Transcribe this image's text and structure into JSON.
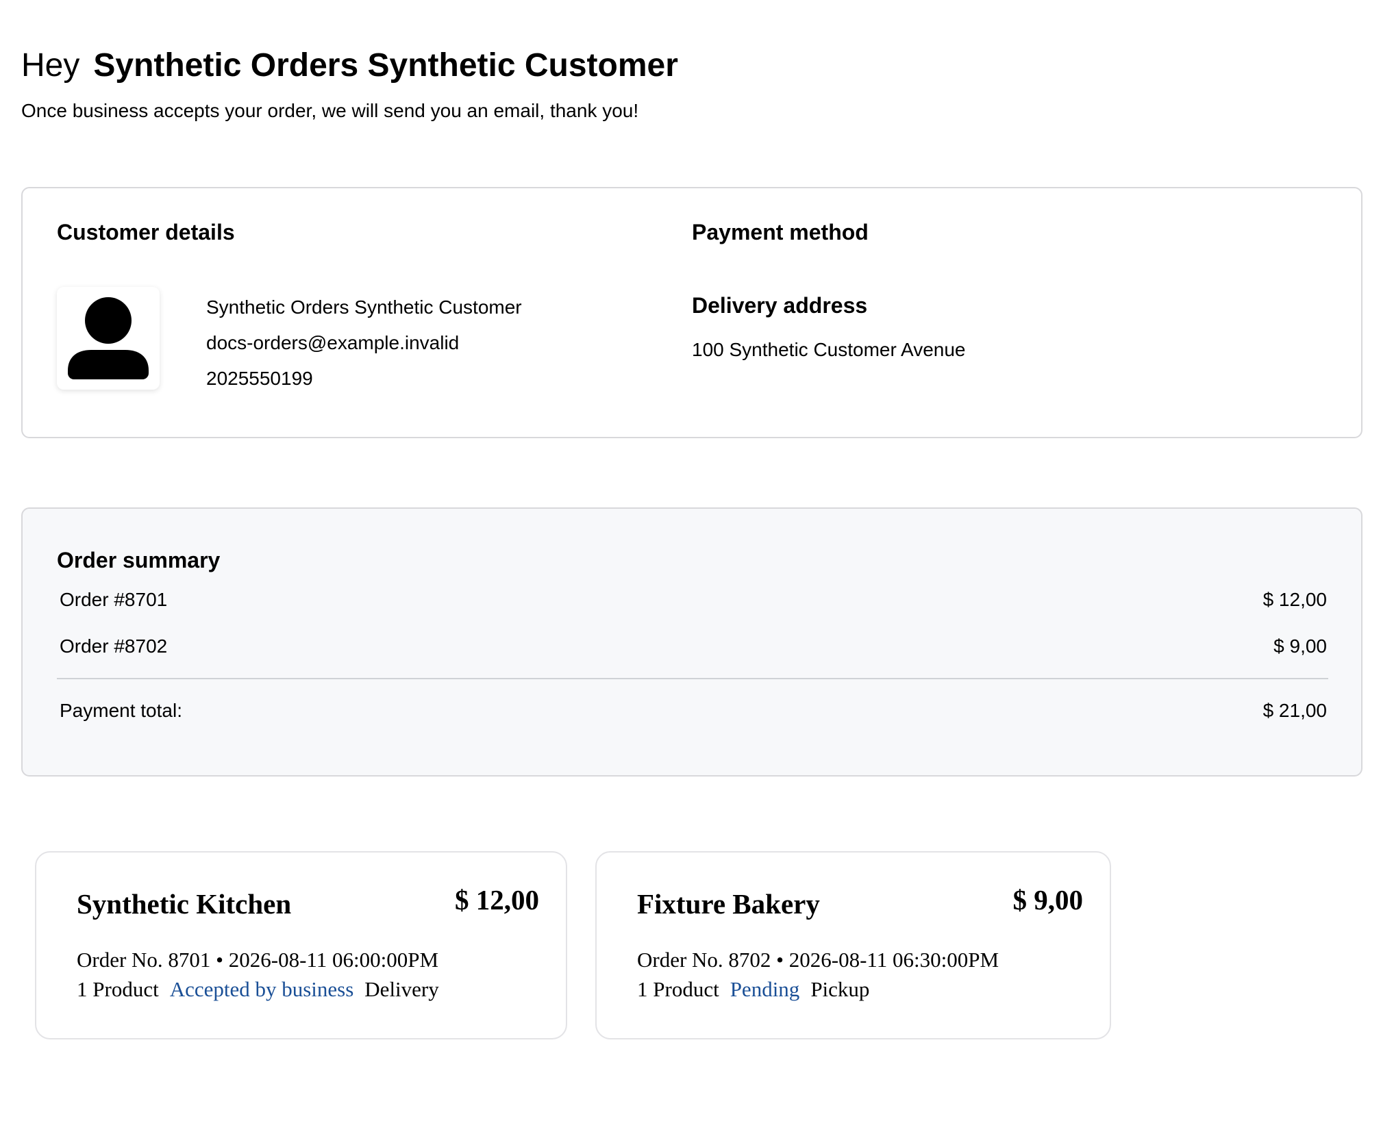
{
  "greeting": {
    "prefix": "Hey",
    "name": "Synthetic Orders Synthetic Customer",
    "message": "Once business accepts your order, we will send you an email, thank you!"
  },
  "customer_details": {
    "title": "Customer details",
    "avatar_icon": "user-icon",
    "name": "Synthetic Orders Synthetic Customer",
    "email": "docs-orders@example.invalid",
    "phone": "2025550199"
  },
  "payment": {
    "title": "Payment method"
  },
  "delivery": {
    "title": "Delivery address",
    "address": "100 Synthetic Customer Avenue"
  },
  "summary": {
    "title": "Order summary",
    "rows": [
      {
        "label": "Order #8701",
        "amount": "$ 12,00"
      },
      {
        "label": "Order #8702",
        "amount": "$ 9,00"
      }
    ],
    "total_label": "Payment total:",
    "total_amount": "$ 21,00"
  },
  "orders": [
    {
      "store": "Synthetic Kitchen",
      "total": "$ 12,00",
      "meta": "Order No. 8701 • 2026-08-11 06:00:00PM",
      "products": "1 Product",
      "status": "Accepted by business",
      "type": "Delivery"
    },
    {
      "store": "Fixture Bakery",
      "total": "$ 9,00",
      "meta": "Order No. 8702 • 2026-08-11 06:30:00PM",
      "products": "1 Product",
      "status": "Pending",
      "type": "Pickup"
    }
  ],
  "colors": {
    "status_link": "#1a4f96",
    "card_border": "#d8d8db",
    "summary_background": "#f7f8fa"
  }
}
